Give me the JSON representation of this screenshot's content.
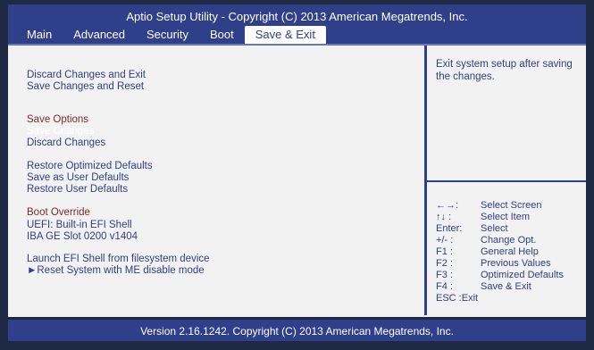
{
  "header": {
    "title": "Aptio Setup Utility - Copyright (C) 2013 American Megatrends, Inc.",
    "tabs": [
      {
        "label": "Main"
      },
      {
        "label": "Advanced"
      },
      {
        "label": "Security"
      },
      {
        "label": "Boot"
      },
      {
        "label": "Save & Exit"
      }
    ]
  },
  "menu": {
    "discard_changes_and_exit": "Discard Changes and Exit",
    "save_changes_and_reset": "Save Changes and Reset",
    "save_options_header": "Save Options",
    "save_changes": "Save Changes",
    "discard_changes": "Discard Changes",
    "restore_optimized_defaults": "Restore Optimized Defaults",
    "save_as_user_defaults": "Save as User Defaults",
    "restore_user_defaults": "Restore User Defaults",
    "boot_override_header": "Boot Override",
    "uefi_built_in_efi_shell": "UEFI: Built-in EFI Shell",
    "iba_ge_slot": "IBA GE Slot 0200 v1404",
    "launch_efi_shell": "Launch EFI Shell from filesystem device",
    "reset_system_me_disable": "►Reset System with ME disable mode"
  },
  "help": {
    "text": "Exit system setup after saving the changes."
  },
  "keys": [
    {
      "key": "←→:",
      "desc": "Select Screen"
    },
    {
      "key": "↑↓ :",
      "desc": "Select Item"
    },
    {
      "key": "Enter:",
      "desc": "Select"
    },
    {
      "key": "+/- :",
      "desc": "Change Opt."
    },
    {
      "key": "F1 :",
      "desc": "General Help"
    },
    {
      "key": "F2 :",
      "desc": "Previous Values"
    },
    {
      "key": "F3 :",
      "desc": "Optimized Defaults"
    },
    {
      "key": "F4 :",
      "desc": "Save & Exit"
    },
    {
      "key": "ESC :Exit",
      "desc": ""
    }
  ],
  "status": {
    "text": "Version 2.16.1242. Copyright (C) 2013 American Megatrends, Inc."
  },
  "colors": {
    "bios_blue": "#2f3f8a",
    "background": "#f2f2f2",
    "text": "#2f3f8a",
    "header_text": "#7a2a2a"
  }
}
